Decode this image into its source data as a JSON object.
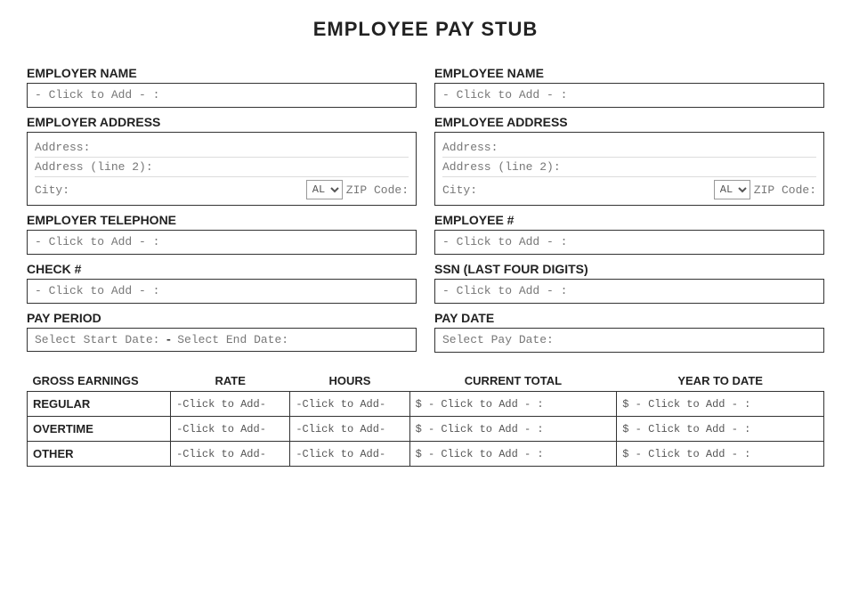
{
  "title": "EMPLOYEE PAY STUB",
  "left": {
    "employer_name_label": "EMPLOYER NAME",
    "employer_name_placeholder": "- Click to Add - :",
    "employer_address_label": "EMPLOYER ADDRESS",
    "address_line1": "Address:",
    "address_line2": "Address (line 2):",
    "city_label": "City:",
    "state_default": "AL",
    "zip_label": "ZIP Code:",
    "employer_tel_label": "EMPLOYER TELEPHONE",
    "employer_tel_placeholder": "- Click to Add - :",
    "check_label": "CHECK #",
    "check_placeholder": "- Click to Add - :",
    "pay_period_label": "PAY PERIOD",
    "pay_period_start": "Select Start Date:",
    "pay_period_dash": "-",
    "pay_period_end": "Select End Date:"
  },
  "right": {
    "employee_name_label": "EMPLOYEE NAME",
    "employee_name_placeholder": "- Click to Add - :",
    "employee_address_label": "EMPLOYEE ADDRESS",
    "address_line1": "Address:",
    "address_line2": "Address (line 2):",
    "city_label": "City:",
    "state_default": "AL",
    "zip_label": "ZIP Code:",
    "employee_num_label": "EMPLOYEE #",
    "employee_num_placeholder": "- Click to Add - :",
    "ssn_label": "SSN (LAST FOUR DIGITS)",
    "ssn_placeholder": "- Click to Add - :",
    "pay_date_label": "PAY DATE",
    "pay_date_placeholder": "Select Pay Date:"
  },
  "earnings": {
    "col_gross": "GROSS EARNINGS",
    "col_rate": "RATE",
    "col_hours": "HOURS",
    "col_current": "CURRENT TOTAL",
    "col_ytd": "YEAR TO DATE",
    "rows": [
      {
        "label": "REGULAR",
        "rate": "-Click to Add-",
        "hours": "-Click to Add-",
        "current": "$ - Click to Add - :",
        "ytd": "$ - Click to Add - :"
      },
      {
        "label": "OVERTIME",
        "rate": "-Click to Add-",
        "hours": "-Click to Add-",
        "current": "$ - Click to Add - :",
        "ytd": "$ - Click to Add - :"
      },
      {
        "label": "OTHER",
        "rate": "-Click to Add-",
        "hours": "-Click to Add-",
        "current": "$ - Click to Add - :",
        "ytd": "$ - Click to Add - :"
      }
    ]
  }
}
